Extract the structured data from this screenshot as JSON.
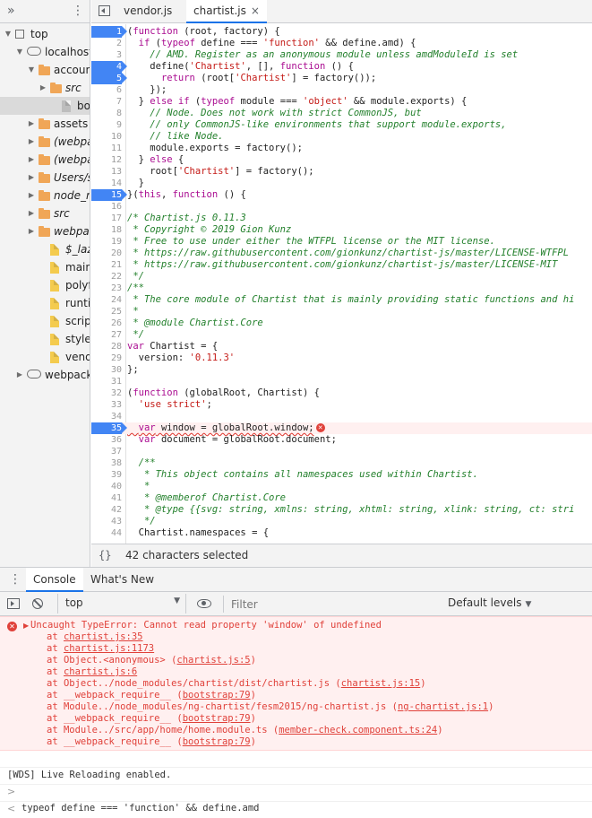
{
  "navigator": {
    "more_label": "»",
    "menu_label": "⋮",
    "items": [
      {
        "label": "top",
        "italic": false,
        "type": "frame",
        "depth": 0,
        "arrow": "down"
      },
      {
        "label": "localhost:",
        "italic": false,
        "type": "cloud",
        "depth": 1,
        "arrow": "down"
      },
      {
        "label": "accoun",
        "italic": false,
        "type": "folder",
        "depth": 2,
        "arrow": "down"
      },
      {
        "label": "src",
        "italic": true,
        "type": "folder",
        "depth": 3,
        "arrow": "right"
      },
      {
        "label": "book",
        "italic": false,
        "type": "file-gray",
        "depth": 4,
        "arrow": "",
        "selected": true
      },
      {
        "label": "assets",
        "italic": false,
        "type": "folder",
        "depth": 2,
        "arrow": "right"
      },
      {
        "label": "(webpa",
        "italic": true,
        "type": "folder",
        "depth": 2,
        "arrow": "right"
      },
      {
        "label": "(webpa",
        "italic": true,
        "type": "folder",
        "depth": 2,
        "arrow": "right"
      },
      {
        "label": "Users/s",
        "italic": true,
        "type": "folder",
        "depth": 2,
        "arrow": "right"
      },
      {
        "label": "node_m",
        "italic": true,
        "type": "folder",
        "depth": 2,
        "arrow": "right"
      },
      {
        "label": "src",
        "italic": true,
        "type": "folder",
        "depth": 2,
        "arrow": "right"
      },
      {
        "label": "webpac",
        "italic": true,
        "type": "folder",
        "depth": 2,
        "arrow": "right"
      },
      {
        "label": "$_lazy_",
        "italic": true,
        "type": "file",
        "depth": 3,
        "arrow": ""
      },
      {
        "label": "main.js",
        "italic": false,
        "type": "file",
        "depth": 3,
        "arrow": ""
      },
      {
        "label": "polyfills",
        "italic": false,
        "type": "file",
        "depth": 3,
        "arrow": ""
      },
      {
        "label": "runtime",
        "italic": false,
        "type": "file",
        "depth": 3,
        "arrow": ""
      },
      {
        "label": "scripts.",
        "italic": false,
        "type": "file",
        "depth": 3,
        "arrow": ""
      },
      {
        "label": "styles.js",
        "italic": false,
        "type": "file",
        "depth": 3,
        "arrow": ""
      },
      {
        "label": "vendor.",
        "italic": false,
        "type": "file",
        "depth": 3,
        "arrow": ""
      },
      {
        "label": "webpack:",
        "italic": false,
        "type": "cloud",
        "depth": 1,
        "arrow": "right"
      }
    ]
  },
  "editor": {
    "tabs": [
      {
        "label": "vendor.js",
        "active": false
      },
      {
        "label": "chartist.js",
        "active": true,
        "close": "×"
      }
    ],
    "lines": [
      {
        "n": "1",
        "bp": true,
        "text": "(function (root, factory) {"
      },
      {
        "n": "2",
        "text": "  if (typeof define === 'function' && define.amd) {"
      },
      {
        "n": "3",
        "text": "    // AMD. Register as an anonymous module unless amdModuleId is set",
        "style": "comment"
      },
      {
        "n": "4",
        "bp": true,
        "text": "    define('Chartist', [], function () {"
      },
      {
        "n": "5",
        "bp": true,
        "text": "      return (root['Chartist'] = factory());"
      },
      {
        "n": "6",
        "text": "    });"
      },
      {
        "n": "7",
        "text": "  } else if (typeof module === 'object' && module.exports) {"
      },
      {
        "n": "8",
        "text": "    // Node. Does not work with strict CommonJS, but",
        "style": "comment"
      },
      {
        "n": "9",
        "text": "    // only CommonJS-like environments that support module.exports,",
        "style": "comment"
      },
      {
        "n": "10",
        "text": "    // like Node.",
        "style": "comment"
      },
      {
        "n": "11",
        "text": "    module.exports = factory();"
      },
      {
        "n": "12",
        "text": "  } else {"
      },
      {
        "n": "13",
        "text": "    root['Chartist'] = factory();"
      },
      {
        "n": "14",
        "text": "  }"
      },
      {
        "n": "15",
        "bp": true,
        "text": "}(this, function () {"
      },
      {
        "n": "16",
        "text": ""
      },
      {
        "n": "17",
        "text": "/* Chartist.js 0.11.3",
        "style": "comment"
      },
      {
        "n": "18",
        "text": " * Copyright © 2019 Gion Kunz",
        "style": "comment"
      },
      {
        "n": "19",
        "text": " * Free to use under either the WTFPL license or the MIT license.",
        "style": "comment"
      },
      {
        "n": "20",
        "text": " * https://raw.githubusercontent.com/gionkunz/chartist-js/master/LICENSE-WTFPL",
        "style": "comment"
      },
      {
        "n": "21",
        "text": " * https://raw.githubusercontent.com/gionkunz/chartist-js/master/LICENSE-MIT",
        "style": "comment"
      },
      {
        "n": "22",
        "text": " */",
        "style": "comment"
      },
      {
        "n": "23",
        "text": "/**",
        "style": "comment"
      },
      {
        "n": "24",
        "text": " * The core module of Chartist that is mainly providing static functions and hi",
        "style": "comment"
      },
      {
        "n": "25",
        "text": " *",
        "style": "comment"
      },
      {
        "n": "26",
        "text": " * @module Chartist.Core",
        "style": "comment"
      },
      {
        "n": "27",
        "text": " */",
        "style": "comment"
      },
      {
        "n": "28",
        "text": "var Chartist = {"
      },
      {
        "n": "29",
        "text": "  version: '0.11.3'"
      },
      {
        "n": "30",
        "text": "};"
      },
      {
        "n": "31",
        "text": ""
      },
      {
        "n": "32",
        "text": "(function (globalRoot, Chartist) {"
      },
      {
        "n": "33",
        "text": "  'use strict';"
      },
      {
        "n": "34",
        "text": ""
      },
      {
        "n": "35",
        "bp": true,
        "err": true,
        "text": "  var window = globalRoot.window;"
      },
      {
        "n": "36",
        "text": "  var document = globalRoot.document;"
      },
      {
        "n": "37",
        "text": ""
      },
      {
        "n": "38",
        "text": "  /**",
        "style": "comment"
      },
      {
        "n": "39",
        "text": "   * This object contains all namespaces used within Chartist.",
        "style": "comment"
      },
      {
        "n": "40",
        "text": "   *",
        "style": "comment"
      },
      {
        "n": "41",
        "text": "   * @memberof Chartist.Core",
        "style": "comment"
      },
      {
        "n": "42",
        "text": "   * @type {{svg: string, xmlns: string, xhtml: string, xlink: string, ct: stri",
        "style": "comment"
      },
      {
        "n": "43",
        "text": "   */",
        "style": "comment"
      },
      {
        "n": "44",
        "text": "  Chartist.namespaces = {"
      }
    ],
    "status": {
      "braces": "{}",
      "selection": "42 characters selected"
    }
  },
  "drawer": {
    "menu_label": "⋮",
    "tabs": [
      {
        "label": "Console",
        "active": true
      },
      {
        "label": "What's New",
        "active": false
      }
    ],
    "toolbar": {
      "context": "top",
      "filter_placeholder": "Filter",
      "levels": "Default levels"
    },
    "error": {
      "headline": "Uncaught TypeError: Cannot read property 'window' of undefined",
      "stack": [
        {
          "prefix": "at ",
          "fn": "",
          "loc": "chartist.js:35"
        },
        {
          "prefix": "at ",
          "fn": "",
          "loc": "chartist.js:1173"
        },
        {
          "prefix": "at ",
          "fn": "Object.<anonymous> (",
          "loc": "chartist.js:5",
          "suffix": ")"
        },
        {
          "prefix": "at ",
          "fn": "",
          "loc": "chartist.js:6"
        },
        {
          "prefix": "at ",
          "fn": "Object../node_modules/chartist/dist/chartist.js (",
          "loc": "chartist.js:15",
          "suffix": ")"
        },
        {
          "prefix": "at ",
          "fn": "__webpack_require__ (",
          "loc": "bootstrap:79",
          "suffix": ")"
        },
        {
          "prefix": "at ",
          "fn": "Module../node_modules/ng-chartist/fesm2015/ng-chartist.js (",
          "loc": "ng-chartist.js:1",
          "suffix": ")"
        },
        {
          "prefix": "at ",
          "fn": "__webpack_require__ (",
          "loc": "bootstrap:79",
          "suffix": ")"
        },
        {
          "prefix": "at ",
          "fn": "Module../src/app/home/home.module.ts (",
          "loc": "member-check.component.ts:24",
          "suffix": ")"
        },
        {
          "prefix": "at ",
          "fn": "__webpack_require__ (",
          "loc": "bootstrap:79",
          "suffix": ")"
        }
      ]
    },
    "log_line": "[WDS] Live Reloading enabled.",
    "input_expr": "typeof define === 'function' && define.amd",
    "result": "false",
    "prompt": ">",
    "result_marker": "<"
  }
}
